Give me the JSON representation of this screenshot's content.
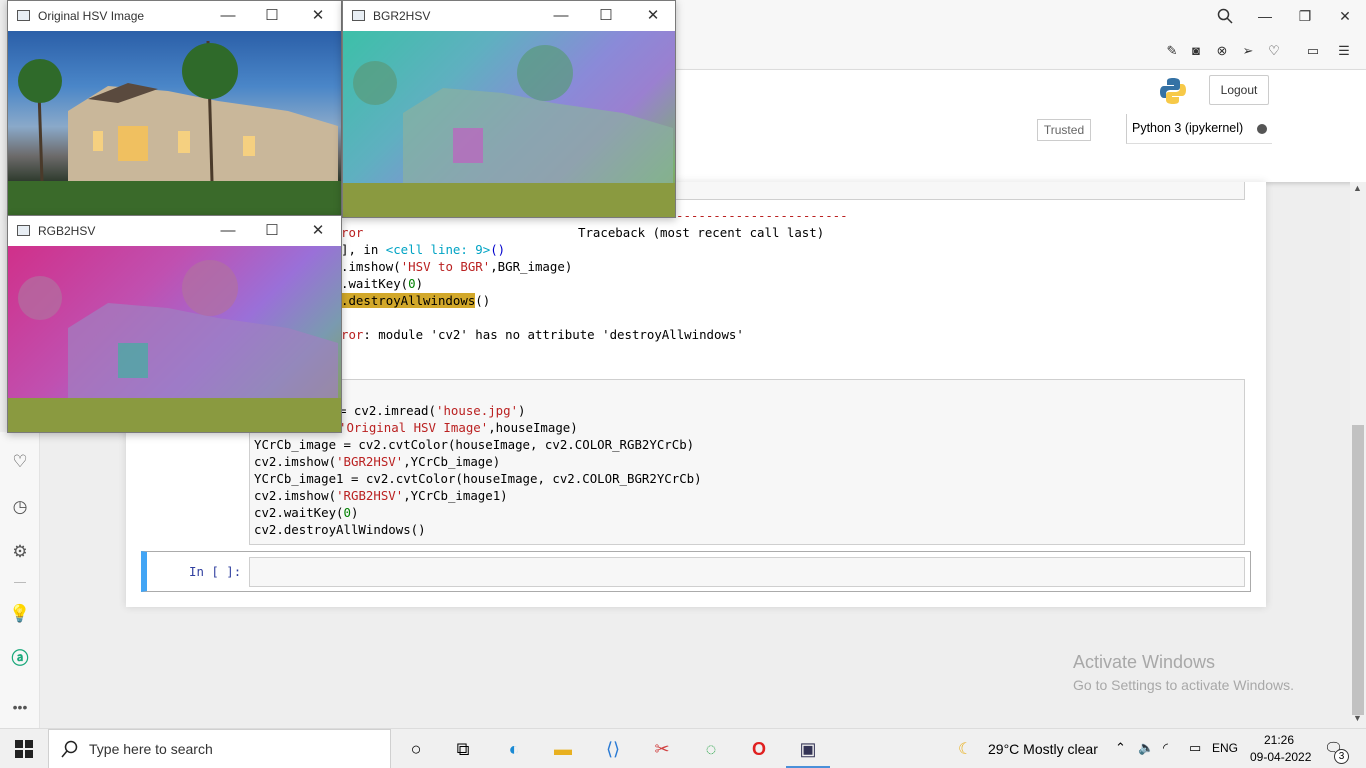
{
  "browser": {
    "top_controls": [
      "search-icon",
      "minimize-icon",
      "restore-icon",
      "close-icon"
    ],
    "toolbar_icons": [
      "edit-icon",
      "camera-icon",
      "block-icon",
      "send-icon",
      "heart-icon",
      "battery-icon",
      "menu-icon"
    ]
  },
  "jupyter": {
    "logout_label": "Logout",
    "trusted_label": "Trusted",
    "kernel_label": "Python 3 (ipykernel)"
  },
  "error_output": {
    "dash_line": "-----------------------",
    "line1_left": "ror",
    "line1_right": "Traceback (most recent call last)",
    "line2_prefix": "], in ",
    "line2_cell": "<cell line: 9>",
    "line2_paren": "()",
    "line3_a": ".imshow(",
    "line3_str": "'HSV to BGR'",
    "line3_b": ",BGR_image)",
    "line4_a": ".waitKey(",
    "line4_num": "0",
    "line4_b": ")",
    "line5_hl": ".destroyAllwindows",
    "line5_b": "()",
    "line6": "ror: module 'cv2' has no attribute 'destroyAllwindows'"
  },
  "code_cell": {
    "l1_a": "= cv2.imread(",
    "l1_str": "'house.jpg'",
    "l1_b": ")",
    "l2_str": "'Original HSV Image'",
    "l2_b": ",houseImage)",
    "l3": "YCrCb_image = cv2.cvtColor(houseImage, cv2.COLOR_RGB2YCrCb)",
    "l4_a": "cv2.imshow(",
    "l4_str": "'BGR2HSV'",
    "l4_b": ",YCrCb_image)",
    "l5": "YCrCb_image1 = cv2.cvtColor(houseImage, cv2.COLOR_BGR2YCrCb)",
    "l6_a": "cv2.imshow(",
    "l6_str": "'RGB2HSV'",
    "l6_b": ",YCrCb_image1)",
    "l7_a": "cv2.waitKey(",
    "l7_num": "0",
    "l7_b": ")",
    "l8": "cv2.destroyAllWindows()"
  },
  "empty_cell": {
    "prompt": "In [ ]:"
  },
  "windows": {
    "original": {
      "title": "Original HSV Image"
    },
    "bgr2hsv": {
      "title": "BGR2HSV"
    },
    "rgb2hsv": {
      "title": "RGB2HSV"
    }
  },
  "watermark": {
    "title": "Activate Windows",
    "subtitle": "Go to Settings to activate Windows."
  },
  "taskbar": {
    "search_placeholder": "Type here to search",
    "weather": "29°C  Mostly clear",
    "language": "ENG",
    "time": "21:26",
    "date": "09-04-2022",
    "notification_count": "3"
  },
  "colors": {
    "cell_prompt_blue": "#42a5f5",
    "highlight": "#d2a82a",
    "string_red": "#ba2121"
  }
}
